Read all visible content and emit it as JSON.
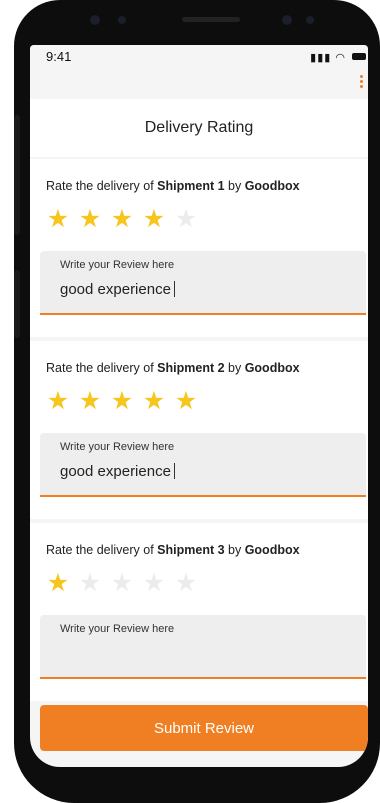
{
  "status": {
    "time": "9:41"
  },
  "header": {
    "title": "Delivery Rating"
  },
  "ratings": [
    {
      "prefix": "Rate the delivery of ",
      "shipment": "Shipment 1",
      "by": " by ",
      "company": "Goodbox",
      "stars": 4,
      "review_label": "Write your Review here",
      "review_value": "good experience"
    },
    {
      "prefix": "Rate the delivery of ",
      "shipment": "Shipment 2",
      "by": " by ",
      "company": "Goodbox",
      "stars": 5,
      "review_label": "Write your Review here",
      "review_value": "good experience"
    },
    {
      "prefix": "Rate the delivery of ",
      "shipment": "Shipment 3",
      "by": " by ",
      "company": "Goodbox",
      "stars": 1,
      "review_label": "Write your Review here",
      "review_value": ""
    }
  ],
  "submit_label": "Submit Review",
  "colors": {
    "accent": "#f07f23",
    "star_filled": "#f6c61d",
    "star_empty": "#ececec"
  },
  "icons": [
    "signal-icon",
    "wifi-icon",
    "battery-icon",
    "kebab-menu-icon",
    "star-icon"
  ]
}
